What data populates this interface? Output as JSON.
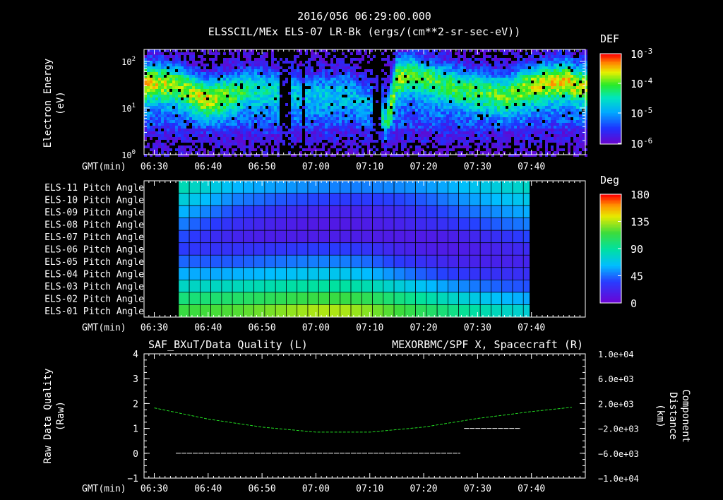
{
  "chart_data": [
    {
      "type": "heatmap",
      "name": "energy-spectrogram",
      "header": "2016/056 06:29:00.000",
      "title": "ELSSCIL/MEx ELS-07 LR-Bk  (ergs/(cm**2-sr-sec-eV))",
      "ylabel": [
        "Electron Energy",
        "(eV)"
      ],
      "xlabel": "GMT(min)",
      "x_range_min": [
        30,
        47.5
      ],
      "x_ticks": [
        "06:30",
        "06:40",
        "06:50",
        "07:00",
        "07:10",
        "07:20",
        "07:30",
        "07:40"
      ],
      "y_scale": "log",
      "ylim": [
        1,
        180
      ],
      "y_tick_labels": [
        {
          "mantissa": "10",
          "exp": "0"
        },
        {
          "mantissa": "10",
          "exp": "1"
        },
        {
          "mantissa": "10",
          "exp": "2"
        }
      ],
      "colorbar": {
        "label": "DEF",
        "scale": "log",
        "range": [
          1e-06,
          0.001
        ],
        "tick_labels": [
          {
            "mantissa": "10",
            "exp": "-3"
          },
          {
            "mantissa": "10",
            "exp": "-4"
          },
          {
            "mantissa": "10",
            "exp": "-5"
          },
          {
            "mantissa": "10",
            "exp": "-6"
          }
        ]
      },
      "features": {
        "data_gaps_min": [
          [
            53.5,
            55.5
          ],
          [
            57.2,
            57.9
          ],
          [
            70.6,
            72.2
          ]
        ],
        "band_minutes": [
          30,
          34,
          40,
          48,
          58,
          66,
          71,
          73,
          75,
          78,
          85,
          95,
          100,
          107,
          108
        ],
        "band_log_energy": [
          1.55,
          1.52,
          1.2,
          1.45,
          1.35,
          1.4,
          1.1,
          0.6,
          1.65,
          1.7,
          1.5,
          1.3,
          1.5,
          1.6,
          1.5
        ],
        "band_intensity": [
          0.75,
          0.65,
          0.65,
          0.45,
          0.3,
          0.3,
          0.15,
          0.35,
          0.7,
          0.65,
          0.55,
          0.55,
          0.7,
          0.8,
          0.7
        ]
      }
    },
    {
      "type": "heatmap",
      "name": "pitch-angle",
      "xlabel": "GMT(min)",
      "x_ticks": [
        "06:30",
        "06:40",
        "06:50",
        "07:00",
        "07:10",
        "07:20",
        "07:30",
        "07:40"
      ],
      "rows": [
        "ELS-11 Pitch Angle",
        "ELS-10 Pitch Angle",
        "ELS-09 Pitch Angle",
        "ELS-08 Pitch Angle",
        "ELS-07 Pitch Angle",
        "ELS-06 Pitch Angle",
        "ELS-05 Pitch Angle",
        "ELS-04 Pitch Angle",
        "ELS-03 Pitch Angle",
        "ELS-02 Pitch Angle",
        "ELS-01 Pitch Angle"
      ],
      "time_minutes": [
        35,
        40,
        45,
        50,
        55,
        60,
        65,
        70,
        75,
        80,
        85,
        90,
        95,
        100,
        105,
        109
      ],
      "values_deg": [
        [
          85,
          75,
          62,
          58,
          55,
          52,
          50,
          50,
          52,
          55,
          60,
          68,
          75,
          80,
          85,
          88
        ],
        [
          75,
          62,
          50,
          45,
          40,
          37,
          35,
          35,
          37,
          42,
          50,
          58,
          65,
          70,
          74,
          78
        ],
        [
          62,
          50,
          38,
          32,
          26,
          22,
          20,
          22,
          26,
          32,
          40,
          48,
          55,
          60,
          63,
          66
        ],
        [
          50,
          38,
          28,
          22,
          18,
          15,
          15,
          17,
          20,
          25,
          30,
          38,
          45,
          50,
          52,
          55
        ],
        [
          40,
          28,
          22,
          18,
          18,
          17,
          18,
          17,
          16,
          16,
          18,
          24,
          30,
          38,
          40,
          42
        ],
        [
          35,
          30,
          30,
          30,
          32,
          35,
          35,
          30,
          22,
          18,
          16,
          18,
          22,
          26,
          30,
          32
        ],
        [
          45,
          42,
          42,
          45,
          48,
          50,
          50,
          45,
          35,
          28,
          22,
          20,
          20,
          22,
          25,
          28
        ],
        [
          60,
          58,
          60,
          62,
          65,
          68,
          68,
          62,
          52,
          42,
          35,
          30,
          28,
          28,
          30,
          32
        ],
        [
          80,
          80,
          82,
          85,
          88,
          90,
          90,
          85,
          75,
          65,
          55,
          48,
          42,
          40,
          40,
          42
        ],
        [
          100,
          102,
          105,
          108,
          112,
          115,
          115,
          110,
          100,
          90,
          80,
          70,
          62,
          58,
          55,
          55
        ],
        [
          115,
          118,
          120,
          125,
          130,
          135,
          135,
          128,
          118,
          108,
          98,
          88,
          80,
          75,
          72,
          72
        ]
      ],
      "colorbar": {
        "label": "Deg",
        "range": [
          0,
          180
        ],
        "tick_labels": [
          "180",
          "135",
          "90",
          "45",
          "0"
        ]
      }
    },
    {
      "type": "line",
      "name": "data-quality-and-position",
      "title_left": "SAF_BXuT/Data Quality (L)",
      "title_right": "MEXORBMC/SPF X, Spacecraft (R)",
      "ylabel_left": [
        "Raw Data Quality",
        "(Raw)"
      ],
      "ylabel_right": [
        "Component",
        "Distance",
        "(km)"
      ],
      "xlabel": "GMT(min)",
      "x_ticks": [
        "06:30",
        "06:40",
        "06:50",
        "07:00",
        "07:10",
        "07:20",
        "07:30",
        "07:40"
      ],
      "ylim_left": [
        -1,
        4
      ],
      "yticks_left": [
        "4",
        "3",
        "2",
        "1",
        "0",
        "−1"
      ],
      "ylim_right": [
        -10000,
        10000
      ],
      "yticks_right": [
        "1.0e+04",
        "6.0e+03",
        "2.0e+03",
        "−2.0e+03",
        "−6.0e+03",
        "−1.0e+04"
      ],
      "colors": {
        "quality": "#ffffff",
        "position": "#22dd22"
      },
      "series": [
        {
          "segments": [
            {
              "x_min": [
                34,
                86.8
              ],
              "y": 0
            },
            {
              "x_min": [
                87.5,
                98
              ],
              "y": 1
            }
          ]
        },
        {
          "x_min": [
            30,
            40,
            50,
            60,
            70,
            80,
            90,
            100,
            107.5
          ],
          "y_km": [
            1300,
            -500,
            -1800,
            -2600,
            -2600,
            -1800,
            -400,
            700,
            1400
          ]
        }
      ]
    }
  ]
}
